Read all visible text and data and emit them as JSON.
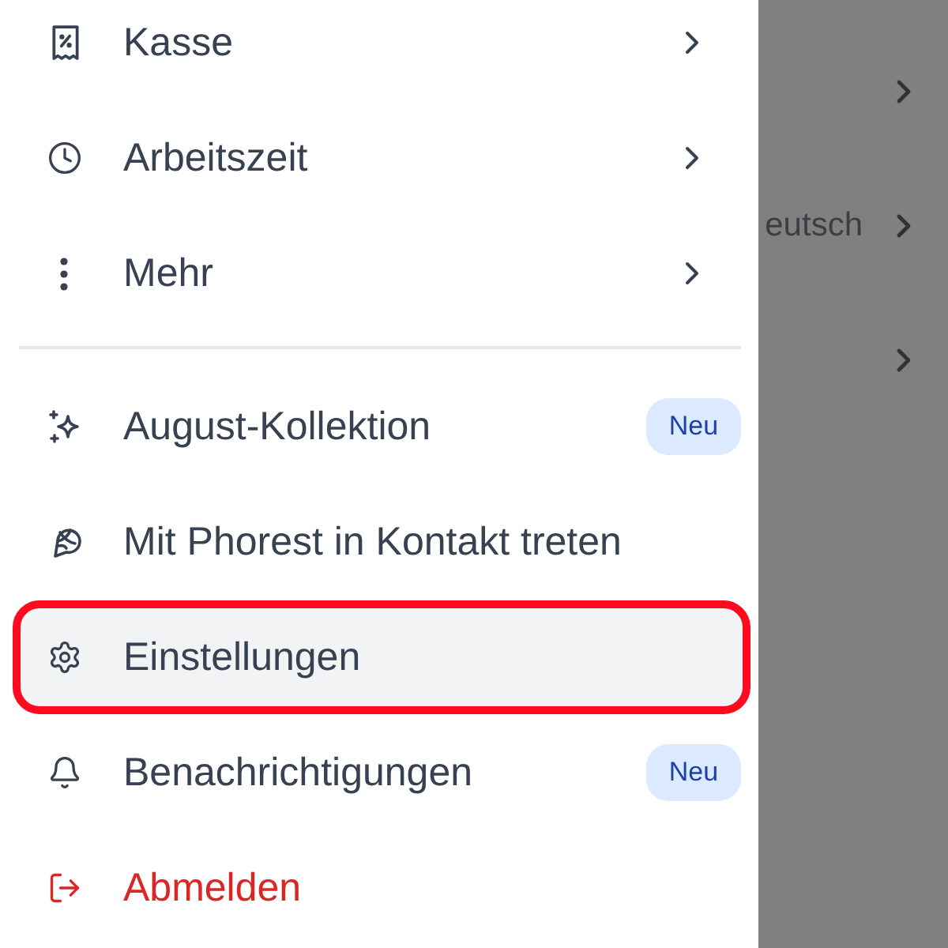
{
  "drawer": {
    "primary_items": [
      {
        "label": "Kasse",
        "chevron": true,
        "selected": false
      },
      {
        "label": "Arbeitszeit",
        "chevron": true,
        "selected": false
      },
      {
        "label": "Mehr",
        "chevron": true,
        "selected": false
      }
    ],
    "secondary_items": [
      {
        "label": "August-Kollektion",
        "badge": "Neu",
        "kind": "default",
        "selected": false
      },
      {
        "label": "Mit Phorest in Kontakt treten",
        "kind": "default",
        "selected": false
      },
      {
        "label": "Einstellungen",
        "kind": "default",
        "selected": true
      },
      {
        "label": "Benachrichtigungen",
        "badge": "Neu",
        "kind": "default",
        "selected": false
      },
      {
        "label": "Abmelden",
        "kind": "danger",
        "selected": false
      }
    ]
  },
  "background_page": {
    "rows": [
      {
        "chevron": true
      },
      {
        "value": "eutsch",
        "chevron": true
      },
      {
        "chevron": true
      }
    ]
  }
}
